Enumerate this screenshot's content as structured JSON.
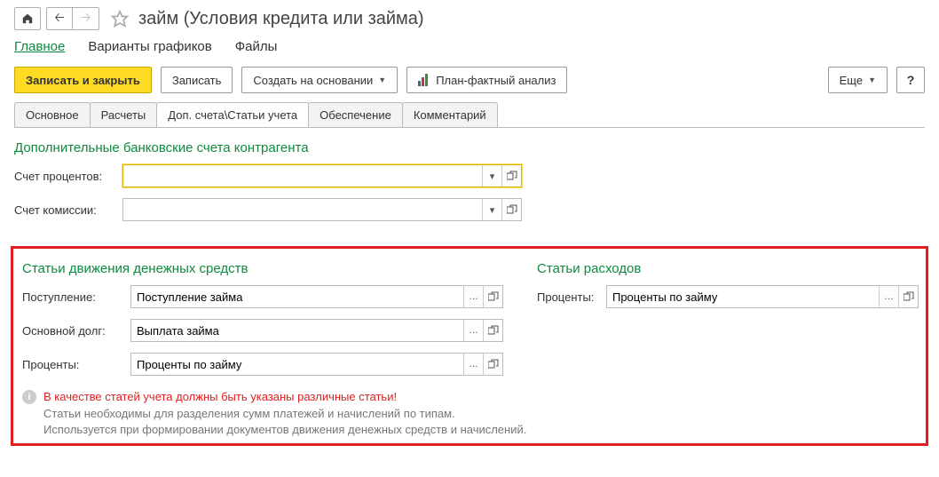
{
  "title": "займ (Условия кредита или займа)",
  "menu": {
    "main": "Главное",
    "variants": "Варианты графиков",
    "files": "Файлы"
  },
  "toolbar": {
    "save_close": "Записать и закрыть",
    "save": "Записать",
    "create_based": "Создать на основании",
    "plan_fact": "План-фактный анализ",
    "more": "Еще",
    "help": "?"
  },
  "tabs": {
    "main": "Основное",
    "calc": "Расчеты",
    "accounts": "Доп. счета\\Статьи учета",
    "collateral": "Обеспечение",
    "comment": "Комментарий"
  },
  "section1": {
    "title": "Дополнительные банковские счета контрагента",
    "interest_account_label": "Счет процентов:",
    "interest_account_value": "",
    "commission_account_label": "Счет комиссии:",
    "commission_account_value": ""
  },
  "section2": {
    "cashflow_title": "Статьи движения денежных средств",
    "inflow_label": "Поступление:",
    "inflow_value": "Поступление займа",
    "principal_label": "Основной долг:",
    "principal_value": "Выплата займа",
    "interest_label": "Проценты:",
    "interest_value": "Проценты по займу",
    "expense_title": "Статьи расходов",
    "exp_interest_label": "Проценты:",
    "exp_interest_value": "Проценты по займу"
  },
  "info": {
    "warning": "В качестве статей учета должны быть указаны различные статьи!",
    "help1": "Статьи необходимы для разделения сумм платежей и начислений по типам.",
    "help2": "Используется при формировании документов движения денежных средств и начислений."
  }
}
